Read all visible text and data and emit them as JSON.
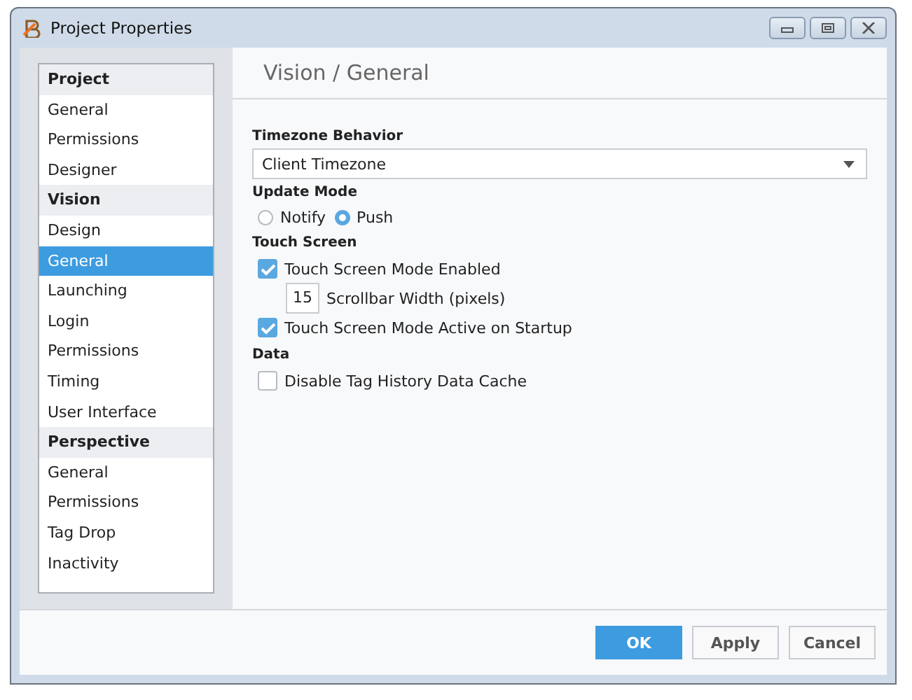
{
  "window": {
    "title": "Project Properties"
  },
  "sidebar": {
    "items": [
      {
        "kind": "header",
        "label": "Project"
      },
      {
        "kind": "item",
        "label": "General",
        "selected": false
      },
      {
        "kind": "item",
        "label": "Permissions",
        "selected": false
      },
      {
        "kind": "item",
        "label": "Designer",
        "selected": false
      },
      {
        "kind": "header",
        "label": "Vision"
      },
      {
        "kind": "item",
        "label": "Design",
        "selected": false
      },
      {
        "kind": "item",
        "label": "General",
        "selected": true
      },
      {
        "kind": "item",
        "label": "Launching",
        "selected": false
      },
      {
        "kind": "item",
        "label": "Login",
        "selected": false
      },
      {
        "kind": "item",
        "label": "Permissions",
        "selected": false
      },
      {
        "kind": "item",
        "label": "Timing",
        "selected": false
      },
      {
        "kind": "item",
        "label": "User Interface",
        "selected": false
      },
      {
        "kind": "header",
        "label": "Perspective"
      },
      {
        "kind": "item",
        "label": "General",
        "selected": false
      },
      {
        "kind": "item",
        "label": "Permissions",
        "selected": false
      },
      {
        "kind": "item",
        "label": "Tag Drop",
        "selected": false
      },
      {
        "kind": "item",
        "label": "Inactivity",
        "selected": false
      }
    ]
  },
  "page": {
    "title": "Vision / General",
    "sections": [
      {
        "kind": "dropdown",
        "label": "Timezone Behavior",
        "value": "Client Timezone"
      },
      {
        "kind": "radios",
        "label": "Update Mode",
        "options": [
          {
            "label": "Notify",
            "selected": false
          },
          {
            "label": "Push",
            "selected": true
          }
        ]
      },
      {
        "kind": "checks",
        "label": "Touch Screen",
        "items": [
          {
            "kind": "checkbox",
            "label": "Touch Screen Mode Enabled",
            "checked": true
          },
          {
            "kind": "number",
            "value": "15",
            "label": "Scrollbar Width (pixels)"
          },
          {
            "kind": "checkbox",
            "label": "Touch Screen Mode Active on Startup",
            "checked": true
          }
        ]
      },
      {
        "kind": "checks",
        "label": "Data",
        "items": [
          {
            "kind": "checkbox",
            "label": "Disable Tag History Data Cache",
            "checked": false
          }
        ]
      }
    ]
  },
  "buttons": [
    {
      "label": "OK",
      "kind": "primary"
    },
    {
      "label": "Apply",
      "kind": "normal"
    },
    {
      "label": "Cancel",
      "kind": "normal"
    }
  ]
}
